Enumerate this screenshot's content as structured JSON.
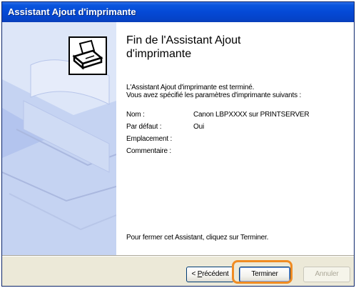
{
  "window": {
    "title": "Assistant Ajout d'imprimante"
  },
  "content": {
    "heading_line1": "Fin de l'Assistant Ajout",
    "heading_line2": "d'imprimante",
    "intro_line1": "L'Assistant Ajout d'imprimante est terminé.",
    "intro_line2": "Vous avez spécifié les paramètres d'imprimante suivants :",
    "details": [
      {
        "label": "Nom :",
        "value": "Canon LBPXXXX sur PRINTSERVER"
      },
      {
        "label": "Par défaut :",
        "value": "Oui"
      },
      {
        "label": "Emplacement :",
        "value": ""
      },
      {
        "label": "Commentaire :",
        "value": ""
      }
    ],
    "footer": "Pour fermer cet Assistant, cliquez sur Terminer."
  },
  "buttons": {
    "prev_prefix": "< ",
    "prev_mnemonic": "P",
    "prev_rest": "récédent",
    "finish": "Terminer",
    "cancel": "Annuler"
  },
  "icons": {
    "side": "printer-icon",
    "highlight": "orange-highlight"
  },
  "colors": {
    "titlebar": "#0549d6",
    "side_panel": "#dde6f8",
    "highlight": "#f08c23",
    "dialog_bg": "#ece9d8"
  }
}
